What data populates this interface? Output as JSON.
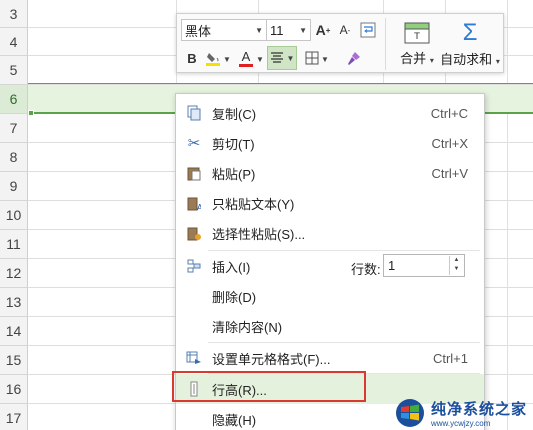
{
  "rows": [
    {
      "num": "3"
    },
    {
      "num": "4"
    },
    {
      "num": "5"
    },
    {
      "num": "6"
    },
    {
      "num": "7"
    },
    {
      "num": "8"
    },
    {
      "num": "9"
    },
    {
      "num": "10"
    },
    {
      "num": "11"
    },
    {
      "num": "12"
    },
    {
      "num": "13"
    },
    {
      "num": "14"
    },
    {
      "num": "15"
    },
    {
      "num": "16"
    },
    {
      "num": "17"
    }
  ],
  "selected_row": "6",
  "colors": {
    "accent": "#5aa34a",
    "selection_fill": "#e6f3df",
    "highlight_box": "#d83a32",
    "sum_icon": "#2e7bd6"
  },
  "toolbar": {
    "font_name": "黑体",
    "font_size": "11",
    "merge_label": "合并",
    "autosum_label": "自动求和",
    "bold_label": "B",
    "font_color_label": "A"
  },
  "menu": {
    "items": [
      {
        "label": "复制(C)",
        "shortcut": "Ctrl+C",
        "icon": "copy-icon"
      },
      {
        "label": "剪切(T)",
        "shortcut": "Ctrl+X",
        "icon": "scissors-icon"
      },
      {
        "label": "粘贴(P)",
        "shortcut": "Ctrl+V",
        "icon": "paste-icon"
      },
      {
        "label": "只粘贴文本(Y)",
        "shortcut": "",
        "icon": "paste-text-icon"
      },
      {
        "label": "选择性粘贴(S)...",
        "shortcut": "",
        "icon": "paste-special-icon"
      },
      {
        "label": "插入(I)",
        "shortcut": "",
        "icon": "insert-row-icon"
      },
      {
        "label": "删除(D)",
        "shortcut": "",
        "icon": ""
      },
      {
        "label": "清除内容(N)",
        "shortcut": "",
        "icon": ""
      },
      {
        "label": "设置单元格格式(F)...",
        "shortcut": "Ctrl+1",
        "icon": "format-cells-icon"
      },
      {
        "label": "行高(R)...",
        "shortcut": "",
        "icon": "row-height-icon"
      },
      {
        "label": "隐藏(H)",
        "shortcut": "",
        "icon": ""
      }
    ],
    "rows_count_label": "行数:",
    "rows_count_value": "1"
  },
  "watermark": {
    "title": "纯净系统之家",
    "url": "www.ycwjzy.com"
  }
}
